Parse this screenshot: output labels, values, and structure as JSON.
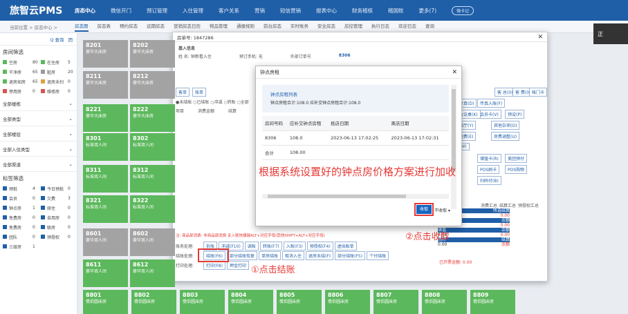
{
  "brand": "旅智云PMS",
  "nav": [
    "房态中心",
    "微信开门",
    "预订管理",
    "入住管理",
    "客户关系",
    "营销",
    "短信营销",
    "报表中心",
    "财务稽核",
    "稽国账",
    "更多(7)"
  ],
  "nav_pill": "微卡记",
  "crumb": {
    "path": "当前位置 > 房态中心 >",
    "tabs": [
      "房态图",
      "房态表",
      "预约房态",
      "远期房态",
      "营销房态日历",
      "物品管理",
      "通报规则",
      "前台房态",
      "实时账务",
      "安全房态",
      "房控管理",
      "执行日志",
      "欢迎日志",
      "查询"
    ]
  },
  "sidebar": {
    "search_label": "Q  查询",
    "legend_label": "团",
    "section1": "房间筛选",
    "rows": [
      {
        "a": "空房",
        "a_n": "80",
        "b": "在住房",
        "b_n": "5",
        "ca": "#5cb85c",
        "cb": "#5cb85c"
      },
      {
        "a": "干净房",
        "a_n": "65",
        "b": "脏房",
        "b_n": "20",
        "ca": "#5cb85c",
        "cb": "#999"
      },
      {
        "a": "退房如房",
        "a_n": "65",
        "b": "退房未扫",
        "b_n": "0",
        "ca": "#5cb85c",
        "cb": "#e0a040"
      },
      {
        "a": "停用房",
        "a_n": "0",
        "b": "维修房",
        "b_n": "0",
        "ca": "#d9534f",
        "cb": "#d9534f"
      }
    ],
    "selects": [
      "全部楼栋",
      "全部类型",
      "全部楼层",
      "全部入住类型",
      "全部渠道"
    ],
    "section2": "标签筛选",
    "rows2": [
      {
        "a": "预抵",
        "a_n": "4",
        "b": "今日预抵",
        "b_n": "0"
      },
      {
        "a": "会员",
        "a_n": "0",
        "b": "欠费",
        "b_n": "3"
      },
      {
        "a": "钟点房",
        "a_n": "1",
        "b": "续住",
        "b_n": "0"
      },
      {
        "a": "免费房",
        "a_n": "0",
        "b": "自用房",
        "b_n": "0"
      },
      {
        "a": "免费房",
        "a_n": "0",
        "b": "联房",
        "b_n": "0"
      },
      {
        "a": "团队",
        "a_n": "0",
        "b": "预授权",
        "b_n": "0"
      },
      {
        "a": "三级房",
        "a_n": "1",
        "b": "",
        "b_n": ""
      }
    ]
  },
  "rooms": [
    {
      "no": "8201",
      "type": "豪华大床房",
      "color": "gray"
    },
    {
      "no": "8202",
      "type": "豪华大床房",
      "color": "gray"
    },
    {
      "no": "8211",
      "type": "豪华大床房",
      "color": "gray"
    },
    {
      "no": "8212",
      "type": "豪华大床房",
      "color": "gray"
    },
    {
      "no": "8221",
      "type": "豪华大床房",
      "color": "green"
    },
    {
      "no": "8222",
      "type": "豪华大床房",
      "color": "green"
    },
    {
      "no": "8301",
      "type": "标准双人间",
      "color": "green"
    },
    {
      "no": "8302",
      "type": "标准双人间",
      "color": "green"
    },
    {
      "no": "8311",
      "type": "标准双人间",
      "color": "green"
    },
    {
      "no": "8312",
      "type": "标准双人间",
      "color": "green"
    },
    {
      "no": "8321",
      "type": "标准双人间",
      "color": "green"
    },
    {
      "no": "8322",
      "type": "标准双人间",
      "color": "green"
    },
    {
      "no": "8601",
      "type": "豪华双人间",
      "color": "gray"
    },
    {
      "no": "8602",
      "type": "豪华双人间",
      "color": "gray"
    },
    {
      "no": "8611",
      "type": "豪华双人间",
      "color": "green"
    },
    {
      "no": "8612",
      "type": "豪华双人间",
      "color": "green"
    }
  ],
  "bottom_rooms": [
    {
      "no": "8801",
      "type": "情侣圆床房"
    },
    {
      "no": "8802",
      "type": "情侣圆床房"
    },
    {
      "no": "8803",
      "type": "情侣圆床房"
    },
    {
      "no": "8804",
      "type": "情侣圆床房"
    },
    {
      "no": "8805",
      "type": "情侣圆床房"
    },
    {
      "no": "8806",
      "type": "情侣圆床房"
    },
    {
      "no": "8807",
      "type": "情侣圆床房"
    },
    {
      "no": "8808",
      "type": "情侣圆床房"
    },
    {
      "no": "8809",
      "type": "情侣圆床房"
    }
  ],
  "mainwin": {
    "title": "房单号: 1847286",
    "section": "基入信息",
    "name_label": "姓  名: 钟新看入住",
    "phone_label": "预订手机: 无",
    "order_label": "外部订单号",
    "room_label": "8306",
    "tabs": [
      "客单",
      "账单"
    ],
    "radio": "●未结账 ○已结账 ○冲减 ○转账 ○全部",
    "col1": "项目",
    "col2": "消费金额",
    "col3": "结算",
    "right_btns": [
      "客 总(0)",
      "客 罚(0)",
      "客 费(0)",
      "帐门卡",
      "传真(D)",
      "传真入账(F)",
      "会员卡(V)",
      "会议桌(K)",
      "预设(P)",
      "餐厅(Y)",
      "其他杂项(O)",
      "税费(E)",
      "房费调整(U)",
      "(W)",
      "储值卡(R)",
      "美团预付",
      "POS刷卡",
      "POS购物",
      "扫码付(B)"
    ],
    "sum_tabs": [
      "消费汇总",
      "结算汇总",
      "预授权汇总"
    ],
    "sum_rows": [
      {
        "k": "消费",
        "v": "所选结算"
      },
      {
        "k": "0.00",
        "v": "0.00"
      },
      {
        "k": "结算",
        "v": "余额"
      },
      {
        "k": "0.00",
        "v": "0.00"
      },
      {
        "k": "储值",
        "v": "余额"
      },
      {
        "k": "0.00",
        "v": "0.00"
      },
      {
        "k": "团付",
        "v": "结算"
      },
      {
        "k": "0.00",
        "v": "余额"
      }
    ],
    "ops_label": "账务处理:",
    "ops_buttons": [
      "拆账",
      "冲减(F10)",
      "调账",
      "转账(F7)",
      "入账(F3)",
      "预授权(F4)",
      "虚拟账单"
    ],
    "settle_label": "结账处理:",
    "settle_buttons": [
      "结账(F6)",
      "部分结账恢复",
      "单房结账",
      "取消入住",
      "退房未结(F)",
      "部分结账(F5)",
      "个付结账"
    ],
    "print_label": "打印处理:",
    "print_buttons": [
      "打印(F8)",
      "押金打印"
    ],
    "hint": "注: 商品部消费: 非商品部消费 走入账快捷键ALT+对应字母(其他SHIFT+ALT+对应字母)",
    "deposit_total": "已开票金额: 0.00"
  },
  "dialog": {
    "title": "钟点房租",
    "box_title": "钟点房租列表",
    "box_sub": "钟点房租合计:108.0 应补交钟点房租合计:108.0",
    "headers": [
      "房间号码",
      "应补交钟点房租",
      "抵店日期",
      "离店日期"
    ],
    "rows": [
      [
        "8306",
        "108.0",
        "2023-06-13 17:02:25",
        "2023-06-13 17:02:31"
      ],
      [
        "合计",
        "108.00",
        "",
        ""
      ]
    ],
    "collect_btn": "收取",
    "no_collect_btn": "不收取"
  },
  "annotations": {
    "main": "根据系统设置好的钟点房价格方案进行加收",
    "step1": "①点击结账",
    "step2": "②点击收取"
  },
  "toast": "正"
}
